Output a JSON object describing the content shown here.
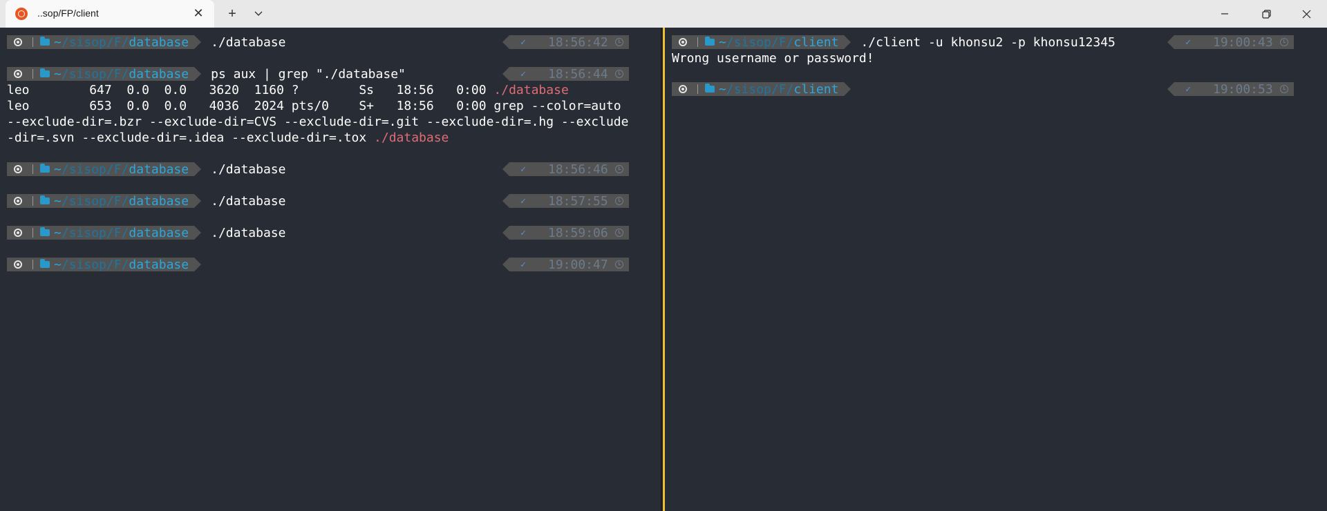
{
  "window": {
    "tab_title": "..sop/FP/client",
    "tab_close": "✕",
    "new_tab": "+",
    "dropdown": "⌄",
    "minimize": "—",
    "restore": "❐",
    "close": "✕"
  },
  "colors": {
    "background": "#282c34",
    "segment": "#525252",
    "path_blue": "#28a8e0",
    "error_red": "#e06c75",
    "pane_border": "#f0c030"
  },
  "left_pane": {
    "prompts": [
      {
        "tilde": "~",
        "sep1": "/",
        "p1": "sisop",
        "sep2": "/",
        "p2": "F",
        "sep3": "/",
        "dir": "database",
        "cmd": "./database",
        "status": "✓",
        "time": "18:56:42"
      },
      {
        "tilde": "~",
        "sep1": "/",
        "p1": "sisop",
        "sep2": "/",
        "p2": "F",
        "sep3": "/",
        "dir": "database",
        "cmd": "ps aux | grep \"./database\"",
        "status": "✓",
        "time": "18:56:44"
      },
      {
        "tilde": "~",
        "sep1": "/",
        "p1": "sisop",
        "sep2": "/",
        "p2": "F",
        "sep3": "/",
        "dir": "database",
        "cmd": "./database",
        "status": "✓",
        "time": "18:56:46"
      },
      {
        "tilde": "~",
        "sep1": "/",
        "p1": "sisop",
        "sep2": "/",
        "p2": "F",
        "sep3": "/",
        "dir": "database",
        "cmd": "./database",
        "status": "✓",
        "time": "18:57:55"
      },
      {
        "tilde": "~",
        "sep1": "/",
        "p1": "sisop",
        "sep2": "/",
        "p2": "F",
        "sep3": "/",
        "dir": "database",
        "cmd": "./database",
        "status": "✓",
        "time": "18:59:06"
      },
      {
        "tilde": "~",
        "sep1": "/",
        "p1": "sisop",
        "sep2": "/",
        "p2": "F",
        "sep3": "/",
        "dir": "database",
        "cmd": "",
        "status": "✓",
        "time": "19:00:47"
      }
    ],
    "output": {
      "line1_text": "leo        647  0.0  0.0   3620  1160 ?        Ss   18:56   0:00 ",
      "line1_red": "./database",
      "line2_text": "leo        653  0.0  0.0   4036  2024 pts/0    S+   18:56   0:00 grep --color=auto",
      "line3_text": "--exclude-dir=.bzr --exclude-dir=CVS --exclude-dir=.git --exclude-dir=.hg --exclude",
      "line4_text": "-dir=.svn --exclude-dir=.idea --exclude-dir=.tox ",
      "line4_red": "./database"
    }
  },
  "right_pane": {
    "prompts": [
      {
        "tilde": "~",
        "sep1": "/",
        "p1": "sisop",
        "sep2": "/",
        "p2": "F",
        "sep3": "/",
        "dir": "client",
        "cmd": "./client -u khonsu2 -p khonsu12345",
        "status": "✓",
        "time": "19:00:43"
      },
      {
        "tilde": "~",
        "sep1": "/",
        "p1": "sisop",
        "sep2": "/",
        "p2": "F",
        "sep3": "/",
        "dir": "client",
        "cmd": "",
        "status": "✓",
        "time": "19:00:53"
      }
    ],
    "output": {
      "error_line": "Wrong username or password!"
    }
  }
}
